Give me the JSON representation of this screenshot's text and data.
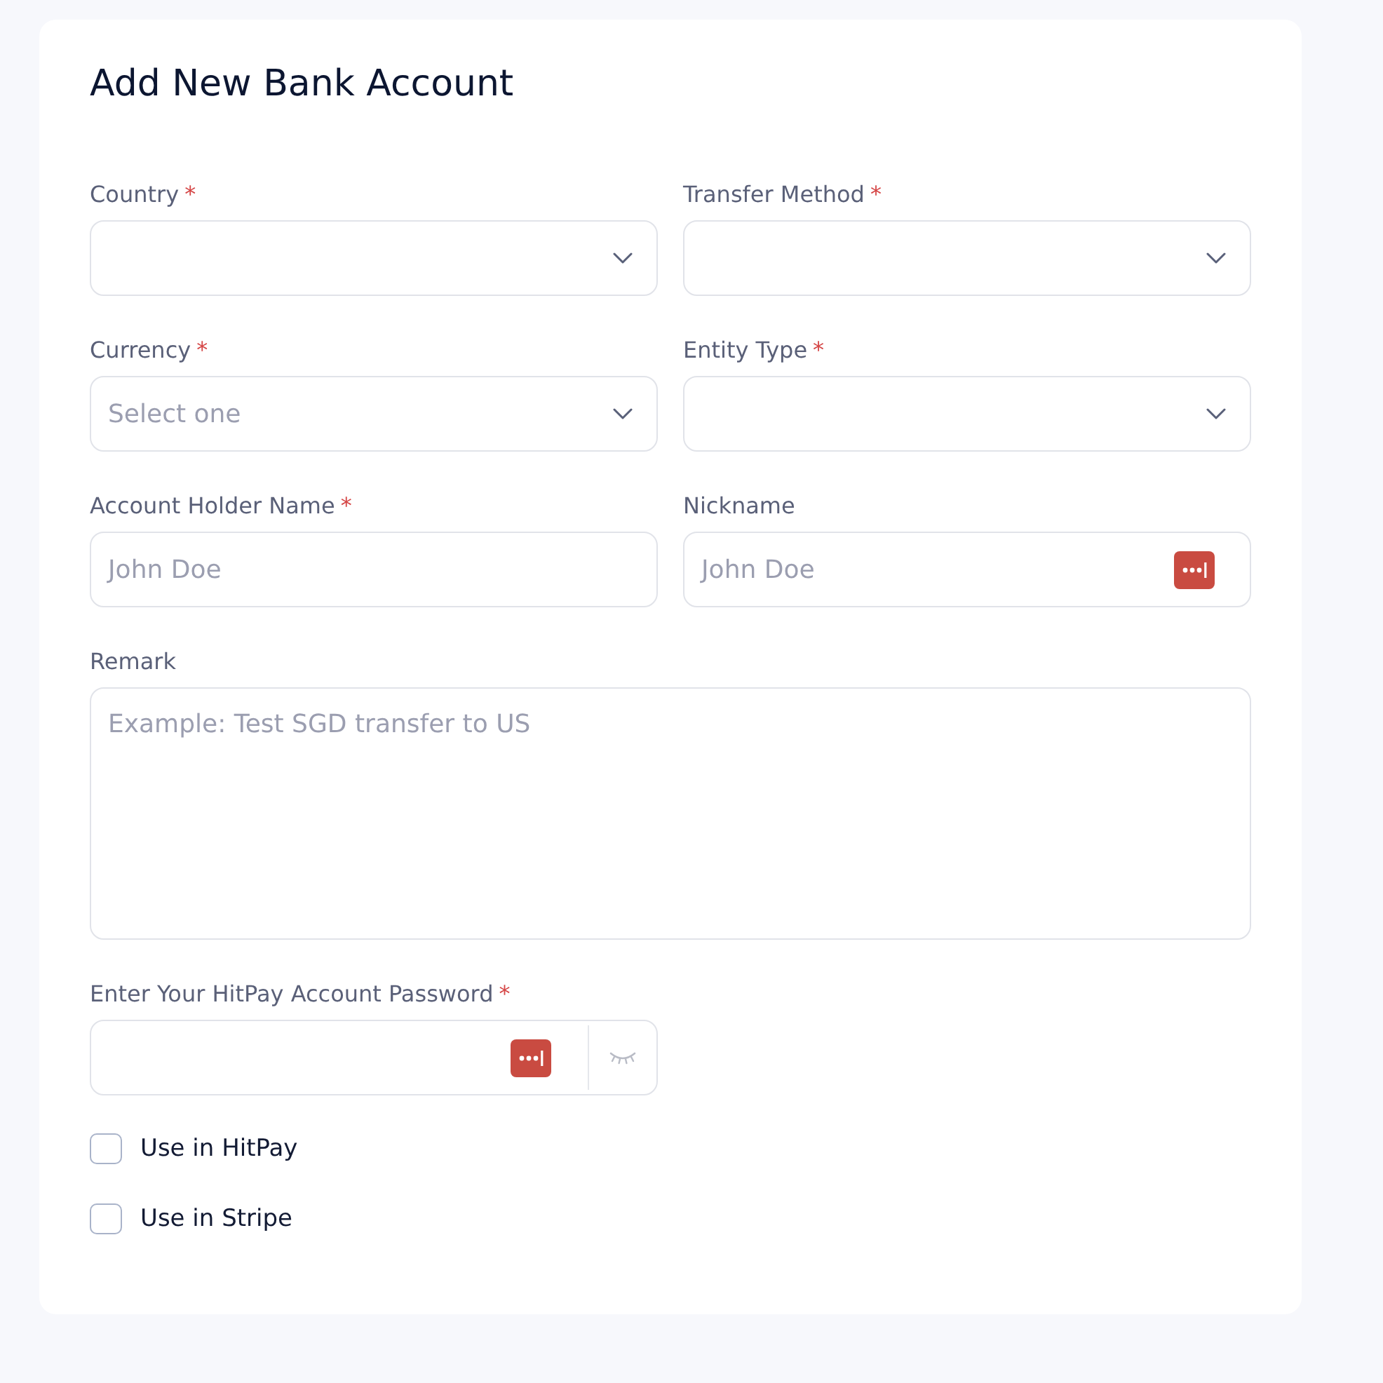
{
  "title": "Add New Bank Account",
  "fields": [
    {
      "kind": "select",
      "label": "Country",
      "required_mark": "*"
    },
    {
      "kind": "select",
      "label": "Transfer Method",
      "required_mark": "*"
    },
    {
      "kind": "select",
      "label": "Currency",
      "required_mark": "*",
      "placeholder": "Select one"
    },
    {
      "kind": "select",
      "label": "Entity Type",
      "required_mark": "*"
    },
    {
      "kind": "text",
      "label": "Account Holder Name",
      "required_mark": "*",
      "placeholder": "John Doe",
      "autofill_badge": false
    },
    {
      "kind": "text",
      "label": "Nickname",
      "placeholder": "John Doe",
      "autofill_badge": true
    },
    {
      "kind": "textarea",
      "label": "Remark",
      "placeholder": "Example: Test SGD transfer to US"
    },
    {
      "kind": "password",
      "label": "Enter Your HitPay Account Password",
      "required_mark": "*",
      "autofill_badge": true,
      "revealed": false
    }
  ],
  "checkboxes": [
    {
      "label": "Use in HitPay",
      "checked": false
    },
    {
      "label": "Use in Stripe",
      "checked": false
    }
  ]
}
